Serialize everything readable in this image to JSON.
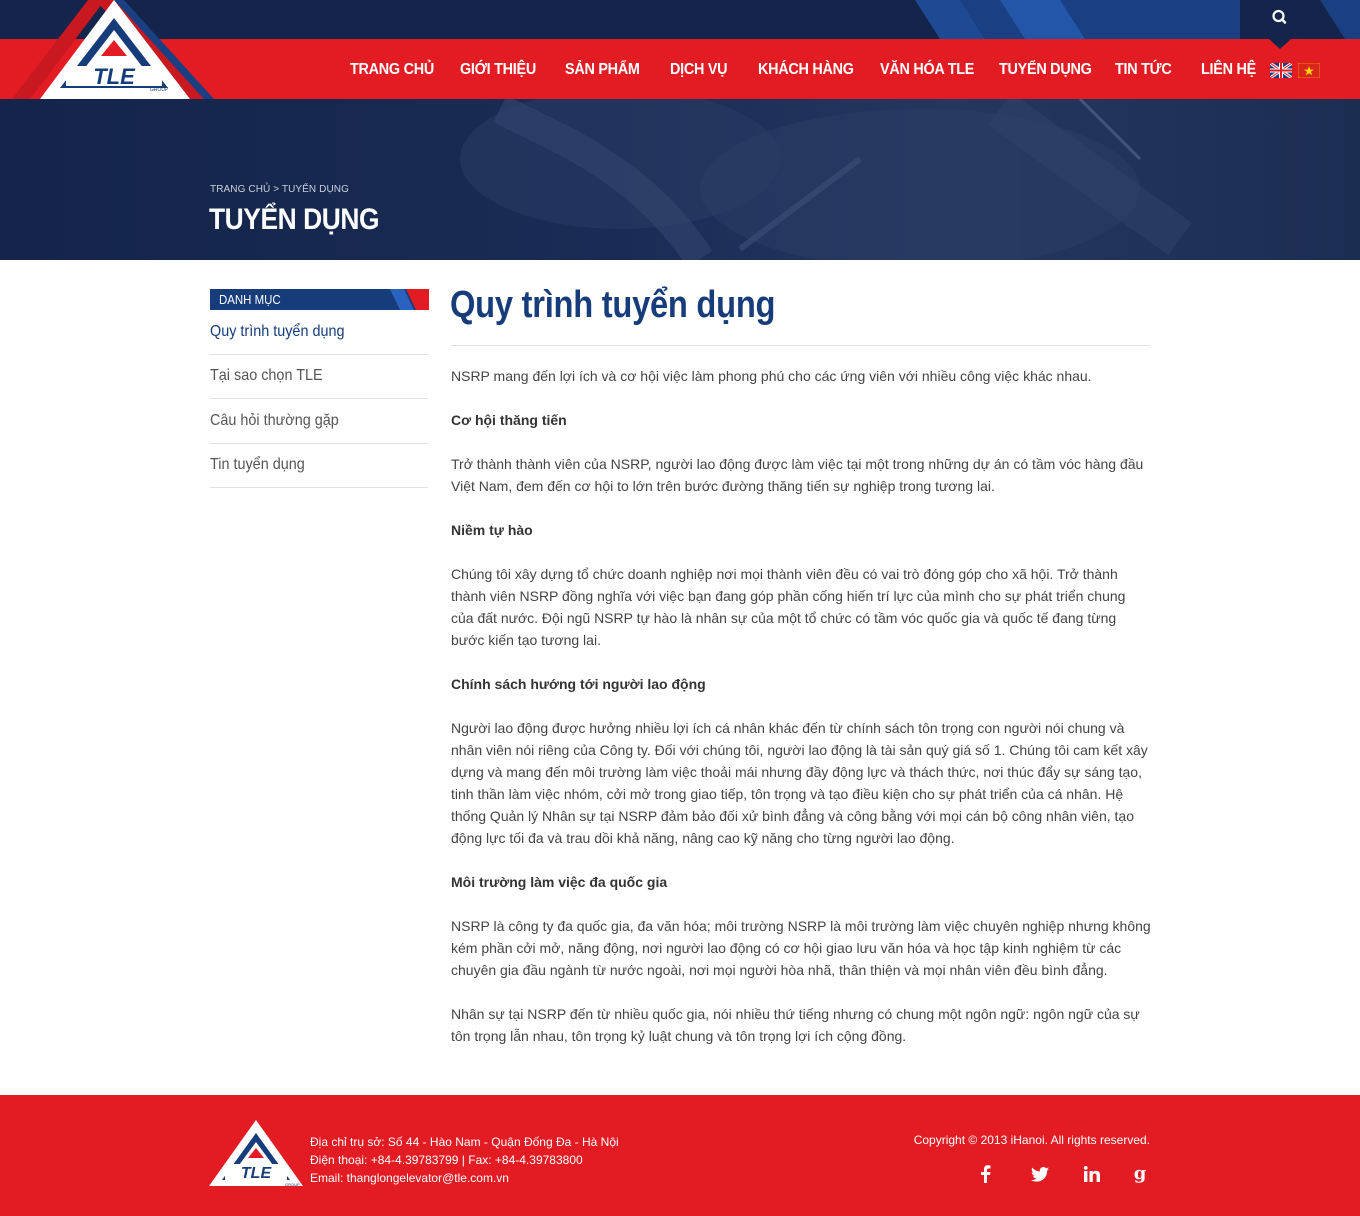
{
  "brand": {
    "logo_text": "TLE",
    "logo_sub": "GROUP"
  },
  "nav": {
    "items": [
      {
        "label": "TRANG CHỦ"
      },
      {
        "label": "GIỚI THIỆU"
      },
      {
        "label": "SẢN PHẨM"
      },
      {
        "label": "DỊCH VỤ"
      },
      {
        "label": "KHÁCH HÀNG"
      },
      {
        "label": "VĂN HÓA TLE"
      },
      {
        "label": "TUYỂN DỤNG"
      },
      {
        "label": "TIN TỨC"
      },
      {
        "label": "LIÊN HỆ"
      }
    ],
    "search_icon": "search-icon",
    "flags": [
      "uk-flag",
      "vietnam-flag"
    ]
  },
  "banner": {
    "breadcrumb": "TRANG CHỦ > TUYỂN DỤNG",
    "title": "TUYỂN DỤNG"
  },
  "sidebar": {
    "heading": "DANH MỤC",
    "items": [
      {
        "label": "Quy trình tuyển dụng",
        "active": true
      },
      {
        "label": "Tại sao chọn TLE"
      },
      {
        "label": "Câu hỏi thường gặp"
      },
      {
        "label": "Tin tuyển dụng"
      }
    ]
  },
  "article": {
    "title": "Quy trình tuyển dụng",
    "intro": "NSRP mang đến lợi ích và cơ hội việc làm phong phú cho các ứng viên với nhiều công việc khác nhau.",
    "h1": "Cơ hội thăng tiến",
    "p1": "Trở thành thành viên của NSRP, người lao động được làm việc tại một trong những dự án có tầm vóc hàng đầu Việt Nam, đem đến cơ hội to lớn trên bước đường thăng tiến sự nghiệp trong tương lai.",
    "h2": "Niềm tự hào",
    "p2": "Chúng tôi xây dựng tổ chức doanh nghiệp nơi mọi thành viên đều có vai trò đóng góp cho xã hội. Trở thành thành viên NSRP đồng nghĩa với việc bạn đang góp phần cống hiến trí lực của mình cho sự phát triển chung của đất nước. Đội ngũ NSRP tự hào là nhân sự của một tổ chức có tầm vóc quốc gia và quốc tế đang từng bước kiến tạo tương lai.",
    "h3": "Chính sách hướng tới người lao động",
    "p3": "Người lao động được hưởng nhiều lợi ích cá nhân khác đến từ chính sách tôn trọng con người nói chung và nhân viên nói riêng của Công ty. Đối với chúng tôi, người lao động là tài sản quý giá số 1. Chúng tôi cam kết xây dựng và mang đến môi trường làm việc thoải mái nhưng đầy động lực và thách thức, nơi thúc đẩy sự sáng tạo, tinh thần làm việc nhóm, cởi mở trong giao tiếp, tôn trọng và tạo điều kiện cho sự phát triển của cá nhân. Hệ thống Quản lý Nhân sự tại NSRP đảm bảo đối xử bình đẳng và công bằng với mọi cán bộ công nhân viên, tạo động lực tối đa và trau dồi khả năng, nâng cao kỹ năng cho từng người lao động.",
    "h4": "Môi trường làm việc đa quốc gia",
    "p4": "NSRP là công ty đa quốc gia, đa văn hóa; môi trường NSRP là môi trường làm việc chuyên nghiệp nhưng không kém phần cởi mở, năng động, nơi người lao động có cơ hội giao lưu văn hóa và học tập kinh nghiệm từ các chuyên gia đầu ngành từ nước ngoài, nơi mọi người hòa nhã, thân thiện và mọi nhân viên đều bình đẳng.",
    "p5": "Nhân sự tại NSRP đến từ nhiều quốc gia, nói nhiều thứ tiếng nhưng có chung một ngôn ngữ: ngôn ngữ của sự tôn trọng lẫn nhau, tôn trọng kỷ luật chung và tôn trọng lợi ích cộng đồng."
  },
  "footer": {
    "address": "Địa chỉ trụ sở: Số 44 - Hào Nam - Quận Đống Đa - Hà Nội",
    "phone": "Điện thoại:  +84-4.39783799  |  Fax: +84-4.39783800",
    "email": "Email: thanglongelevator@tle.com.vn",
    "copyright": "Copyright © 2013 iHanoi. All rights reserved.",
    "social": [
      "facebook-icon",
      "twitter-icon",
      "linkedin-icon",
      "google-plus-icon"
    ]
  },
  "colors": {
    "primary_red": "#e31b23",
    "navy": "#14244a",
    "blue": "#173c7a"
  }
}
